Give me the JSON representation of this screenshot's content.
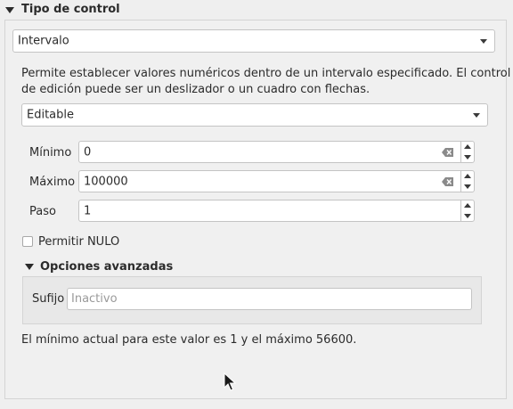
{
  "section": {
    "title": "Tipo de control"
  },
  "widget_type": {
    "selected": "Intervalo"
  },
  "description": {
    "line1": "Permite establecer valores numéricos dentro de un intervalo especificado. El control",
    "line2": "de edición puede ser un deslizador o un cuadro con flechas."
  },
  "style_combo": {
    "selected": "Editable"
  },
  "fields": {
    "min": {
      "label": "Mínimo",
      "value": "0"
    },
    "max": {
      "label": "Máximo",
      "value": "100000"
    },
    "step": {
      "label": "Paso",
      "value": "1"
    }
  },
  "allow_null": {
    "label": "Permitir NULO",
    "checked": false
  },
  "advanced": {
    "title": "Opciones avanzadas",
    "suffix_label": "Sufijo",
    "suffix_placeholder": "Inactivo"
  },
  "footer_text": "El mínimo actual para este valor es 1 y el máximo 56600."
}
